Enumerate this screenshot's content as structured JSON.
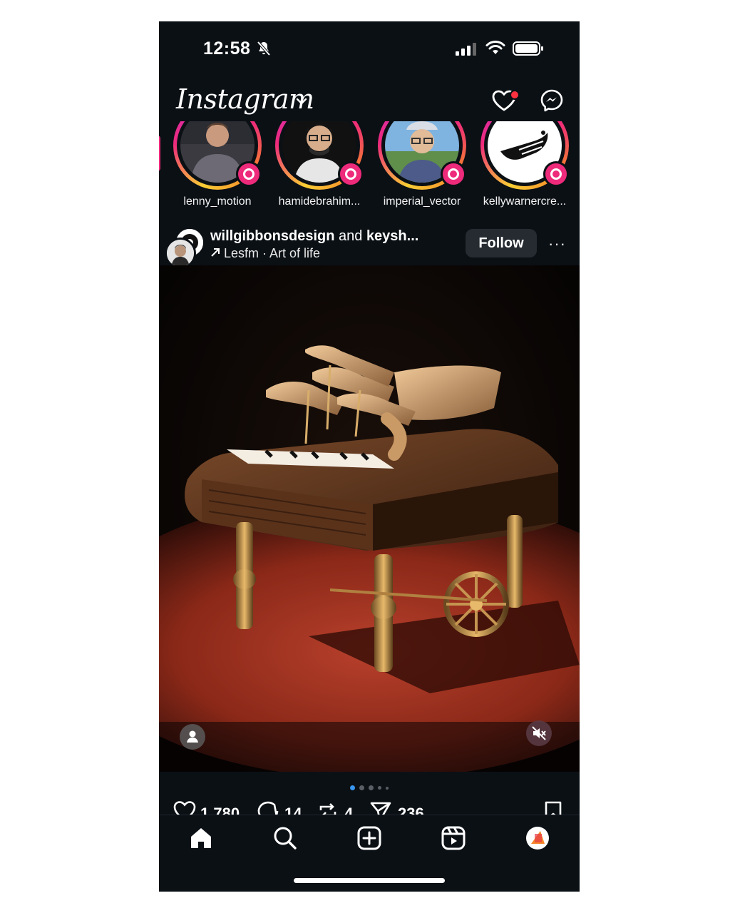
{
  "status_bar": {
    "time": "12:58"
  },
  "header": {
    "logo": "Instagram",
    "icons": [
      "chevron-down-icon",
      "heart-icon",
      "messenger-icon"
    ]
  },
  "stories": [
    {
      "name": "lenny_motion"
    },
    {
      "name": "hamidebrahim..."
    },
    {
      "name": "imperial_vector"
    },
    {
      "name": "kellywarnercre..."
    }
  ],
  "post": {
    "user_primary": "willgibbonsdesign",
    "user_connector": " and ",
    "user_secondary": "keysh...",
    "audio": "Lesfm · Art of life",
    "follow_label": "Follow",
    "more_label": "···",
    "media_description_icons": [
      "user-tag-icon",
      "muted-speaker-icon"
    ],
    "carousel_count": 5,
    "carousel_active": 1,
    "likes": "1,780",
    "comments": "14",
    "reposts": "4",
    "shares": "236"
  },
  "colors": {
    "background": "#0b1015",
    "accent": "#3897f0",
    "notification": "#ff3040",
    "story_ring": "#ee2a7b"
  }
}
